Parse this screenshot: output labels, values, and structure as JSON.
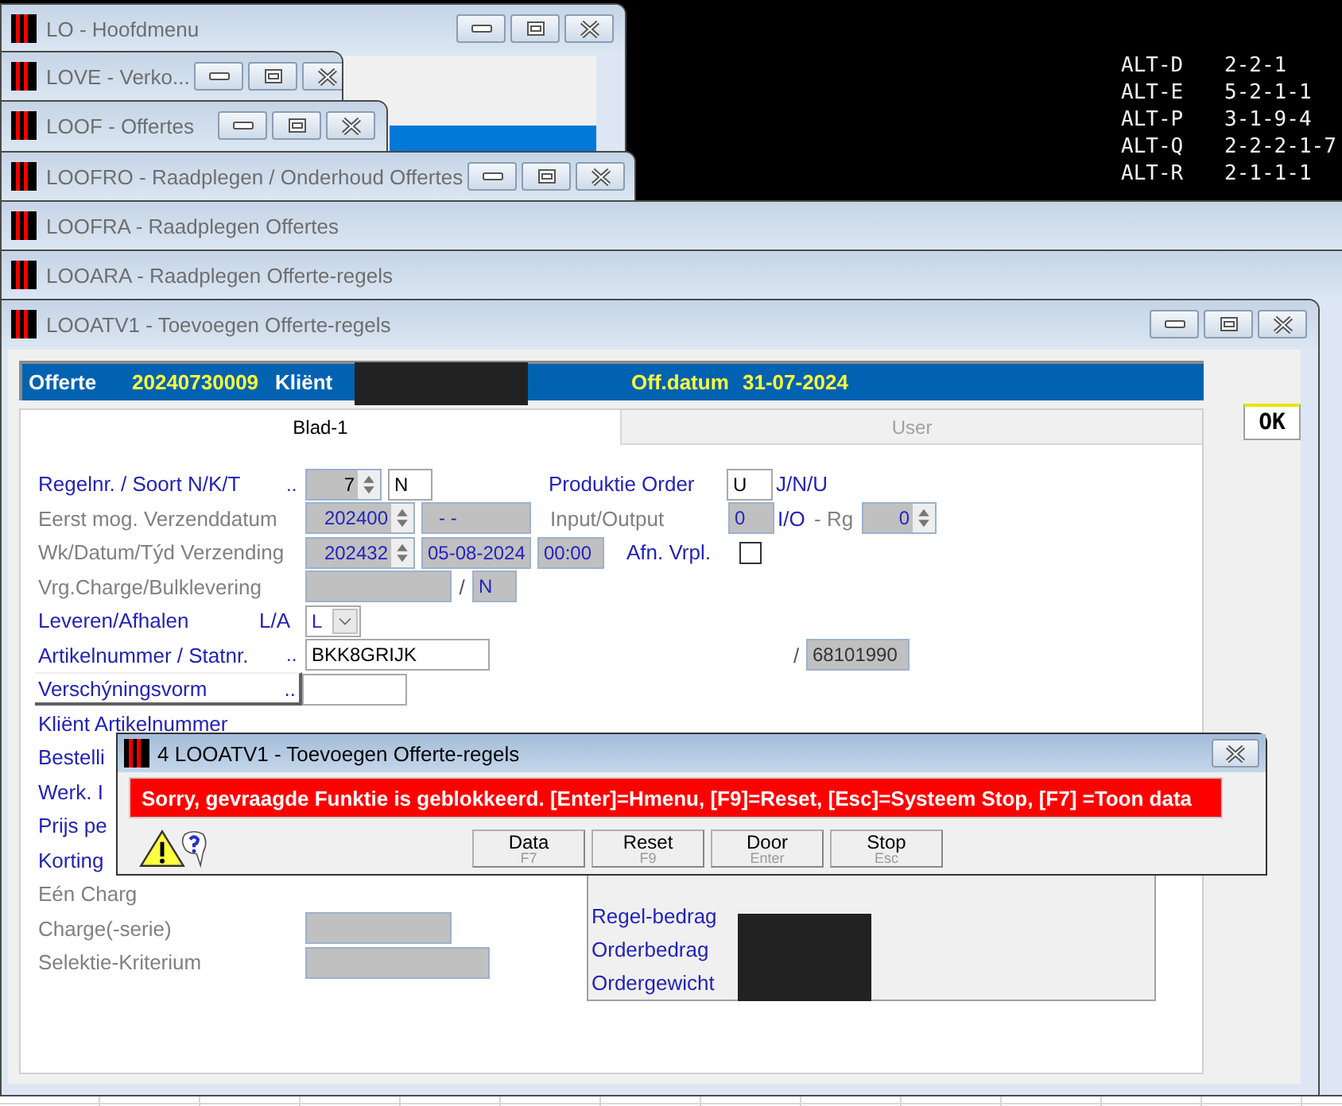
{
  "shortcuts": [
    {
      "key": "ALT-D",
      "value": "2-2-1"
    },
    {
      "key": "ALT-E",
      "value": "5-2-1-1"
    },
    {
      "key": "ALT-P",
      "value": "3-1-9-4"
    },
    {
      "key": "ALT-Q",
      "value": "2-2-2-1-7"
    },
    {
      "key": "ALT-R",
      "value": "2-1-1-1"
    }
  ],
  "windows": [
    {
      "title": "LO - Hoofdmenu",
      "controls": true
    },
    {
      "title": "LOVE - Verko...",
      "controls": true
    },
    {
      "title": "LOOF - Offertes",
      "controls": true
    },
    {
      "title": "LOOFRO - Raadplegen / Onderhoud Offertes",
      "controls": true
    },
    {
      "title": "LOOFRA - Raadplegen Offertes",
      "controls": false
    },
    {
      "title": "LOOARA - Raadplegen Offerte-regels",
      "controls": false
    },
    {
      "title": "LOOATV1 - Toevoegen Offerte-regels",
      "controls": true
    }
  ],
  "header": {
    "offerte_label": "Offerte",
    "offerte_number": "20240730009",
    "client_label": "Kliënt",
    "date_label": "Off.datum",
    "date": "31-07-2024"
  },
  "ok_button": "OK",
  "tabs": [
    {
      "label": "Blad-1",
      "selected": true
    },
    {
      "label": "User",
      "selected": false
    }
  ],
  "form": {
    "regelnr": {
      "label": "Regelnr. / Soort  N/K/T",
      "enabled": true,
      "lookup": "..",
      "number": "7",
      "soort": "N"
    },
    "produktie": {
      "label": "Produktie Order",
      "enabled": true,
      "value": "U",
      "hint": "J/N/U"
    },
    "eerst": {
      "label": "Eerst mog. Verzenddatum",
      "enabled": false,
      "week": "202400",
      "date": "- -"
    },
    "io": {
      "label": "Input/Output",
      "enabled": false,
      "value": "0",
      "unit": "I/O",
      "rg_label": "- Rg",
      "rg": "0"
    },
    "verzending": {
      "label": "Wk/Datum/Týd Verzending",
      "enabled": false,
      "week": "202432",
      "date": "05-08-2024",
      "time": "00:00"
    },
    "afn": {
      "label": "Afn. Vrpl.",
      "enabled": true,
      "checked": false
    },
    "vrg": {
      "label": "Vrg.Charge/Bulklevering",
      "enabled": false,
      "separator": "/",
      "bulk": "N"
    },
    "leveren": {
      "label": "Leveren/Afhalen",
      "enabled": true,
      "hint": "L/A",
      "value": "L"
    },
    "artikel": {
      "label": "Artikelnummer / Statnr.",
      "enabled": true,
      "lookup": "..",
      "value": "BKK8GRIJK",
      "separator": "/",
      "statnr": "68101990"
    },
    "verschijning": {
      "label": "Verschýningsvorm",
      "lookup": ".."
    },
    "partial_rows": [
      {
        "label": "Kliënt Artikelnummer",
        "enabled": true
      },
      {
        "label": "Bestelli",
        "enabled": true
      },
      {
        "label": "Werk. I",
        "enabled": true
      },
      {
        "label": "Prijs pe",
        "enabled": true
      },
      {
        "label": "Korting",
        "enabled": true
      },
      {
        "label": "Eén Charg",
        "enabled": false
      }
    ],
    "charge": {
      "label": "Charge(-serie)",
      "enabled": false
    },
    "selektie": {
      "label": "Selektie-Kriterium",
      "enabled": false
    },
    "totals": [
      {
        "label": "Regel-bedrag"
      },
      {
        "label": "Orderbedrag"
      },
      {
        "label": "Ordergewicht"
      }
    ]
  },
  "dialog": {
    "title": "4 LOOATV1 - Toevoegen Offerte-regels",
    "message": "Sorry, gevraagde Funktie is geblokkeerd.  [Enter]=Hmenu, [F9]=Reset, [Esc]=Systeem Stop, [F7] =Toon data",
    "buttons": [
      {
        "label": "Data",
        "key": "F7"
      },
      {
        "label": "Reset",
        "key": "F9"
      },
      {
        "label": "Door",
        "key": "Enter"
      },
      {
        "label": "Stop",
        "key": "Esc"
      }
    ]
  }
}
